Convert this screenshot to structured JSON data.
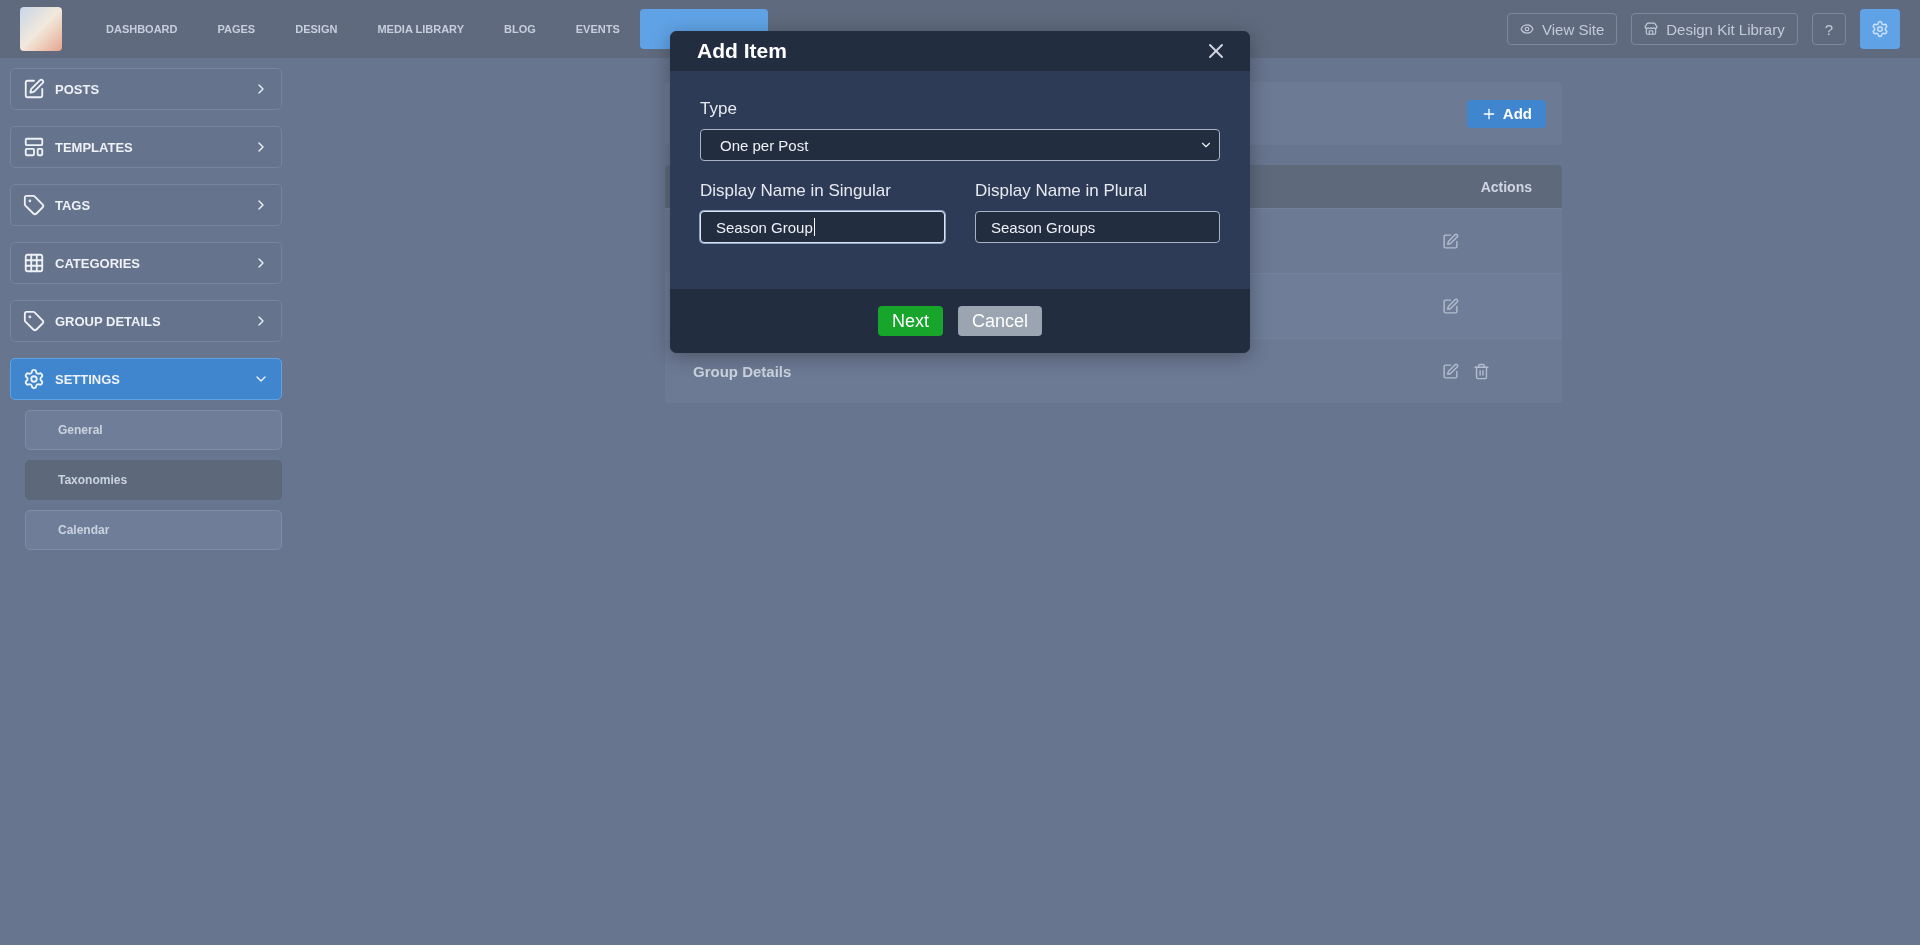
{
  "nav": {
    "tabs": [
      {
        "label": "DASHBOARD",
        "selected": false
      },
      {
        "label": "PAGES",
        "selected": false
      },
      {
        "label": "DESIGN",
        "selected": false
      },
      {
        "label": "MEDIA LIBRARY",
        "selected": false
      },
      {
        "label": "BLOG",
        "selected": false
      },
      {
        "label": "EVENTS",
        "selected": false
      },
      {
        "selected": true
      },
      {
        "selected": false
      },
      {
        "selected": false
      }
    ],
    "actions": [
      {
        "kind": "view",
        "label": "View Site"
      },
      {
        "kind": "library",
        "label": "Design Kit Library"
      },
      {
        "kind": "help",
        "label": "?"
      },
      {
        "kind": "settings"
      }
    ]
  },
  "sidebar": {
    "items": [
      {
        "label": "POSTS",
        "kind": "edit",
        "selected": false,
        "expanded": false
      },
      {
        "label": "TEMPLATES",
        "kind": "template",
        "selected": false,
        "expanded": false
      },
      {
        "label": "TAGS",
        "kind": "tag",
        "selected": false,
        "expanded": false
      },
      {
        "label": "CATEGORIES",
        "kind": "grid",
        "selected": false,
        "expanded": false
      },
      {
        "label": "GROUP DETAILS",
        "kind": "tag",
        "selected": false,
        "expanded": false
      },
      {
        "label": "SETTINGS",
        "kind": "gear",
        "selected": true,
        "expanded": true,
        "children": [
          {
            "label": "General",
            "selected": false
          },
          {
            "label": "Taxonomies",
            "selected": true
          },
          {
            "label": "Calendar",
            "selected": false
          }
        ]
      }
    ]
  },
  "main": {
    "add_button": "Add",
    "table": {
      "columns": [
        "Actions"
      ],
      "rows": [
        {
          "deletable": false
        },
        {
          "deletable": false
        },
        {
          "name": "Group Details",
          "deletable": true
        }
      ]
    }
  },
  "modal": {
    "title": "Add Item",
    "type": {
      "label": "Type",
      "value": "One per Post"
    },
    "fields": [
      {
        "label": "Display Name in Singular",
        "value": "Season Group",
        "focused": true
      },
      {
        "label": "Display Name in Plural",
        "value": "Season Groups",
        "focused": false
      }
    ],
    "buttons": [
      {
        "kind": "primary",
        "label": "Next"
      },
      {
        "kind": "secondary",
        "label": "Cancel"
      }
    ]
  }
}
